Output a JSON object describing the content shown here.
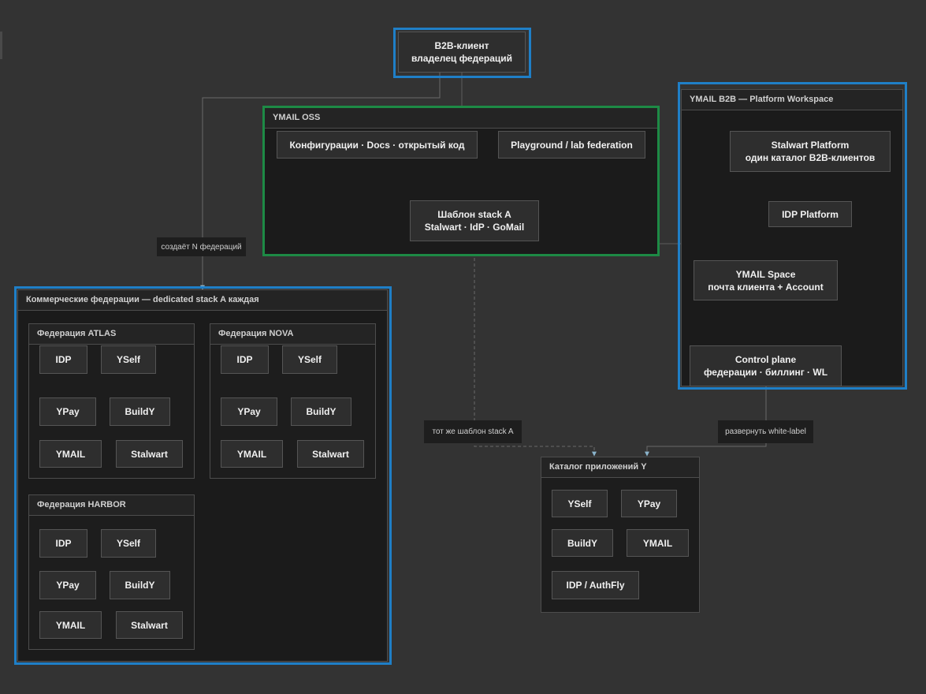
{
  "client": {
    "line1": "B2B-клиент",
    "line2": "владелец федераций"
  },
  "oss": {
    "title": "YMAIL OSS",
    "configs": "Конфигурации · Docs · открытый код",
    "playground": "Playground / lab federation",
    "template_line1": "Шаблон stack A",
    "template_line2": "Stalwart · IdP · GoMail"
  },
  "b2b": {
    "title": "YMAIL B2B — Platform Workspace",
    "stalwart_line1": "Stalwart Platform",
    "stalwart_line2": "один каталог B2B-клиентов",
    "idp": "IDP Platform",
    "space_line1": "YMAIL Space",
    "space_line2": "почта клиента + Account",
    "control_line1": "Control plane",
    "control_line2": "федерации · биллинг · WL"
  },
  "commercial": {
    "title": "Коммерческие федерации — dedicated stack A каждая",
    "federations": [
      {
        "title": "Федерация ATLAS",
        "apps": [
          "IDP",
          "YSelf",
          "YPay",
          "BuildY",
          "YMAIL",
          "Stalwart"
        ]
      },
      {
        "title": "Федерация NOVA",
        "apps": [
          "IDP",
          "YSelf",
          "YPay",
          "BuildY",
          "YMAIL",
          "Stalwart"
        ]
      },
      {
        "title": "Федерация HARBOR",
        "apps": [
          "IDP",
          "YSelf",
          "YPay",
          "BuildY",
          "YMAIL",
          "Stalwart"
        ]
      }
    ]
  },
  "catalog": {
    "title": "Каталог приложений Y",
    "apps": [
      "YSelf",
      "YPay",
      "BuildY",
      "YMAIL",
      "IDP / AuthFly"
    ]
  },
  "edge_labels": {
    "creates": "создаёт N федераций",
    "same_template": "тот же шаблон stack A",
    "deploy_wl": "развернуть white-label"
  }
}
